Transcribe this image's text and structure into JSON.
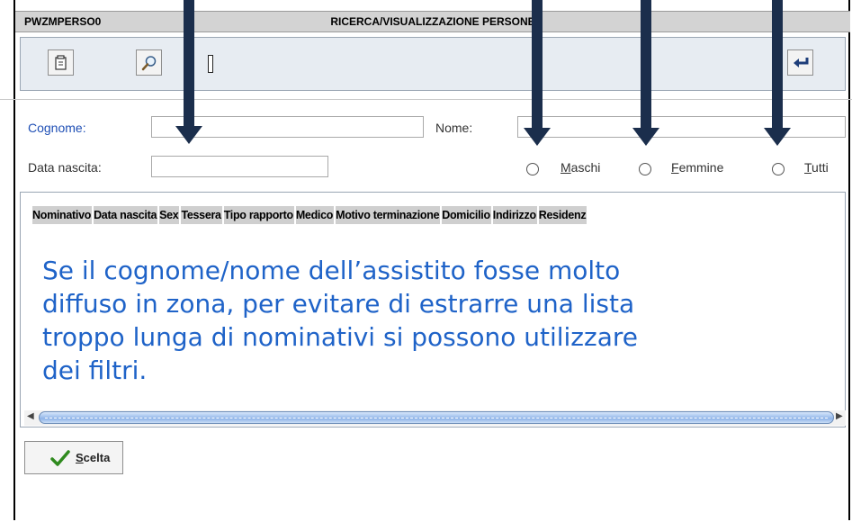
{
  "window": {
    "code": "PWZMPERSO0",
    "title": "RICERCA/VISUALIZZAZIONE PERSONE"
  },
  "toolbar": {
    "buttons": [
      {
        "icon": "clear-form-icon"
      },
      {
        "icon": "search-icon"
      },
      {
        "icon": "back-icon"
      }
    ]
  },
  "filters": {
    "cognome_label": "Cognome:",
    "cognome_value": "",
    "nome_label": "Nome:",
    "nome_value": "",
    "data_nascita_label": "Data nascita:",
    "data_nascita_value": "",
    "sex_options": [
      {
        "label_first": "M",
        "label_rest": "aschi"
      },
      {
        "label_first": "F",
        "label_rest": "emmine"
      },
      {
        "label_first": "T",
        "label_rest": "utti"
      }
    ]
  },
  "results_table": {
    "columns": [
      "Nominativo",
      "Data nascita",
      "Sex",
      "Tessera",
      "Tipo rapporto",
      "Medico",
      "Motivo terminazione",
      "Domicilio",
      "Indirizzo",
      "Residenz"
    ]
  },
  "annotation": {
    "lines": [
      "Se il cognome/nome dell’assistito fosse molto",
      "diffuso in zona, per evitare di estrarre una lista",
      "troppo lunga di nominativi si possono utilizzare",
      "dei filtri."
    ]
  },
  "actions": {
    "scelta_first": "S",
    "scelta_rest": "celta"
  },
  "colors": {
    "annotation_text": "#1f63c8",
    "arrow": "#1b2e4c",
    "label_blue": "#1f4fb5"
  }
}
